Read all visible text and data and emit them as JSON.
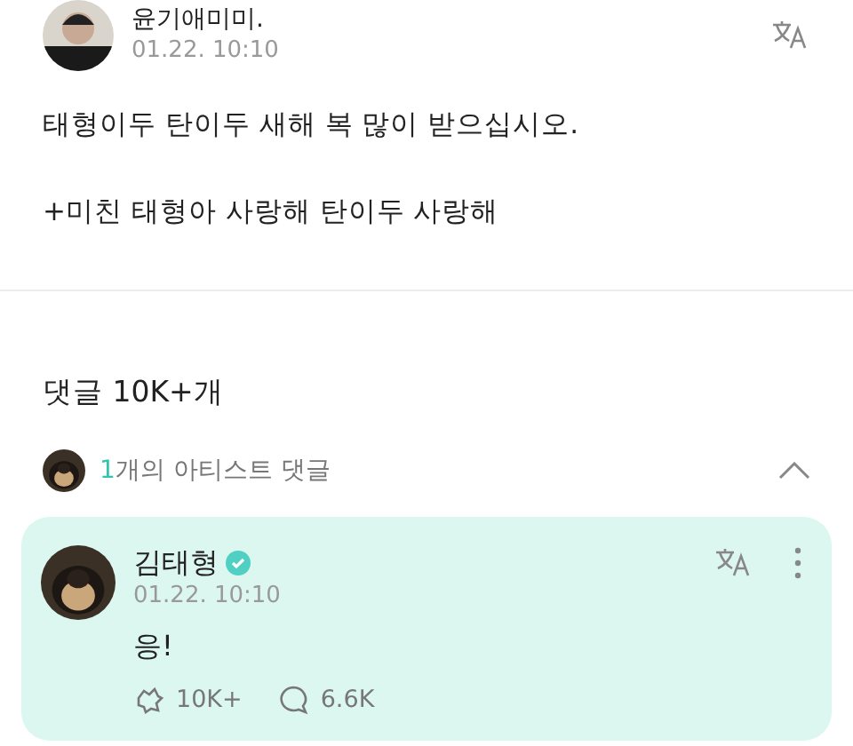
{
  "post": {
    "author": "윤기애미미.",
    "time": "01.22. 10:10",
    "body": [
      "태형이두 탄이두 새해 복 많이 받으십시오.",
      "+미친 태형아 사랑해 탄이두 사랑해"
    ]
  },
  "comments": {
    "title": "댓글 10K+개",
    "artist_summary": {
      "count": "1",
      "label": "개의 아티스트 댓글",
      "expanded": true
    }
  },
  "artist_comment": {
    "author": "김태형",
    "verified": true,
    "time": "01.22. 10:10",
    "text": "응!",
    "likes": "10K+",
    "replies": "6.6K"
  }
}
